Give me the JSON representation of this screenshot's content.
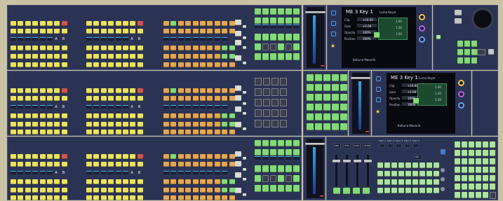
{
  "app": {
    "title": ""
  },
  "colors": {
    "panel": "#2b3354",
    "yellow": "#ece35a",
    "orange": "#e8a64a",
    "red": "#d8514a",
    "green": "#82db73",
    "light_green": "#a9e59a",
    "lcd_cyan": "#47b4e8",
    "frame": "#c9c2a4"
  },
  "row1": {
    "letter_a_1": "A",
    "letter_b_1": "B",
    "letter_a_2": "A",
    "letter_b_2": "B",
    "menu_screen": {
      "title": "ME 3 Key 1",
      "tab": "Luma Keyer",
      "footer": "Kahuna Maverik",
      "label_clip": "Clip",
      "label_gain": "Gain",
      "label_opacity": "Opacity",
      "label_position": "Position",
      "value_clip": "+10.02",
      "value_gain": "+1.00",
      "value_opacity": "100%",
      "value_position": "100%",
      "right_value_1": "1.00",
      "right_value_2": "1.00",
      "right_value_3": "1.00"
    }
  },
  "row2": {
    "letter_a_1": "A",
    "letter_b_1": "B",
    "letter_a_2": "A",
    "letter_b_2": "B",
    "menu_screen": {
      "title": "ME 3 Key 1",
      "tab": "Luma Keyer",
      "footer": "Kahuna Maverik",
      "label_clip": "Clip",
      "label_gain": "Gain",
      "label_opacity": "Opacity",
      "label_position": "Position",
      "value_clip": "+10.02",
      "value_gain": "+1.00",
      "value_opacity": "100%",
      "value_position": "100%",
      "right_value_1": "1.00",
      "right_value_2": "1.00",
      "right_value_3": "1.00"
    }
  },
  "row3": {
    "letter_a_1": "A",
    "letter_b_1": "B",
    "letter_a_2": "A",
    "letter_b_2": "B",
    "macro_labels": [
      "SEQ",
      "VTR",
      "DDR",
      "STOR"
    ],
    "mem_labels": [
      "Mem 1",
      "Mem 2",
      "Mem 3",
      "Mem 4",
      "Mem 5"
    ],
    "sel_label": "SEL"
  }
}
